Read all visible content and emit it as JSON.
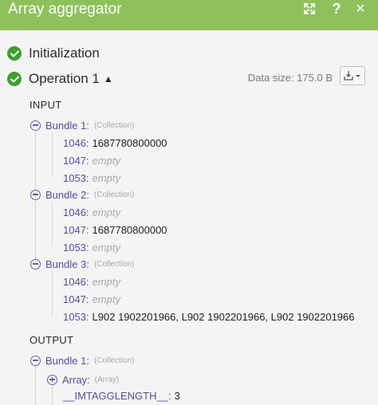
{
  "header": {
    "title": "Array aggregator",
    "help": "?",
    "close": "×"
  },
  "colors": {
    "header_bg": "#8ec15c",
    "success": "#3c9f2f",
    "key": "#5c4a9a"
  },
  "steps": {
    "initialization": "Initialization",
    "operation": "Operation 1"
  },
  "data_size": "Data size: 175.0 B",
  "input": {
    "label": "INPUT",
    "bundles": [
      {
        "name": "Bundle 1:",
        "type": "(Collection)",
        "rows": [
          {
            "key": "1046:",
            "value": "1687780800000"
          },
          {
            "key": "1047:",
            "value": "empty"
          },
          {
            "key": "1053:",
            "value": "empty"
          }
        ]
      },
      {
        "name": "Bundle 2:",
        "type": "(Collection)",
        "rows": [
          {
            "key": "1046:",
            "value": "empty"
          },
          {
            "key": "1047:",
            "value": "1687780800000"
          },
          {
            "key": "1053:",
            "value": "empty"
          }
        ]
      },
      {
        "name": "Bundle 3:",
        "type": "(Collection)",
        "rows": [
          {
            "key": "1046:",
            "value": "empty"
          },
          {
            "key": "1047:",
            "value": "empty"
          },
          {
            "key": "1053:",
            "value": "L902 1902201966, L902 1902201966, L902 1902201966"
          }
        ]
      }
    ]
  },
  "output": {
    "label": "OUTPUT",
    "bundle": {
      "name": "Bundle 1:",
      "type": "(Collection)",
      "array": {
        "name": "Array:",
        "type": "(Array)"
      },
      "length": {
        "key": "__IMTAGGLENGTH__:",
        "value": "3"
      }
    }
  }
}
